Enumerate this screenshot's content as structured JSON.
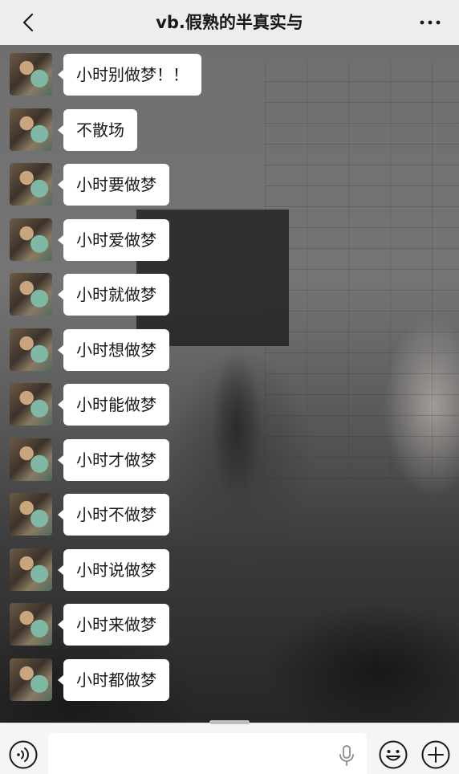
{
  "header": {
    "title": "vb.假熟的半真实与",
    "back_icon": "chevron-left-icon",
    "more_icon": "ellipsis-icon"
  },
  "messages": [
    {
      "text": "小时别做梦！！"
    },
    {
      "text": "不散场"
    },
    {
      "text": "小时要做梦"
    },
    {
      "text": "小时爱做梦"
    },
    {
      "text": "小时就做梦"
    },
    {
      "text": "小时想做梦"
    },
    {
      "text": "小时能做梦"
    },
    {
      "text": "小时才做梦"
    },
    {
      "text": "小时不做梦"
    },
    {
      "text": "小时说做梦"
    },
    {
      "text": "小时来做梦"
    },
    {
      "text": "小时都做梦"
    }
  ],
  "input_bar": {
    "value": "",
    "voice_icon": "voice-input-icon",
    "mic_icon": "microphone-icon",
    "emoji_icon": "emoji-icon",
    "plus_icon": "plus-icon"
  }
}
